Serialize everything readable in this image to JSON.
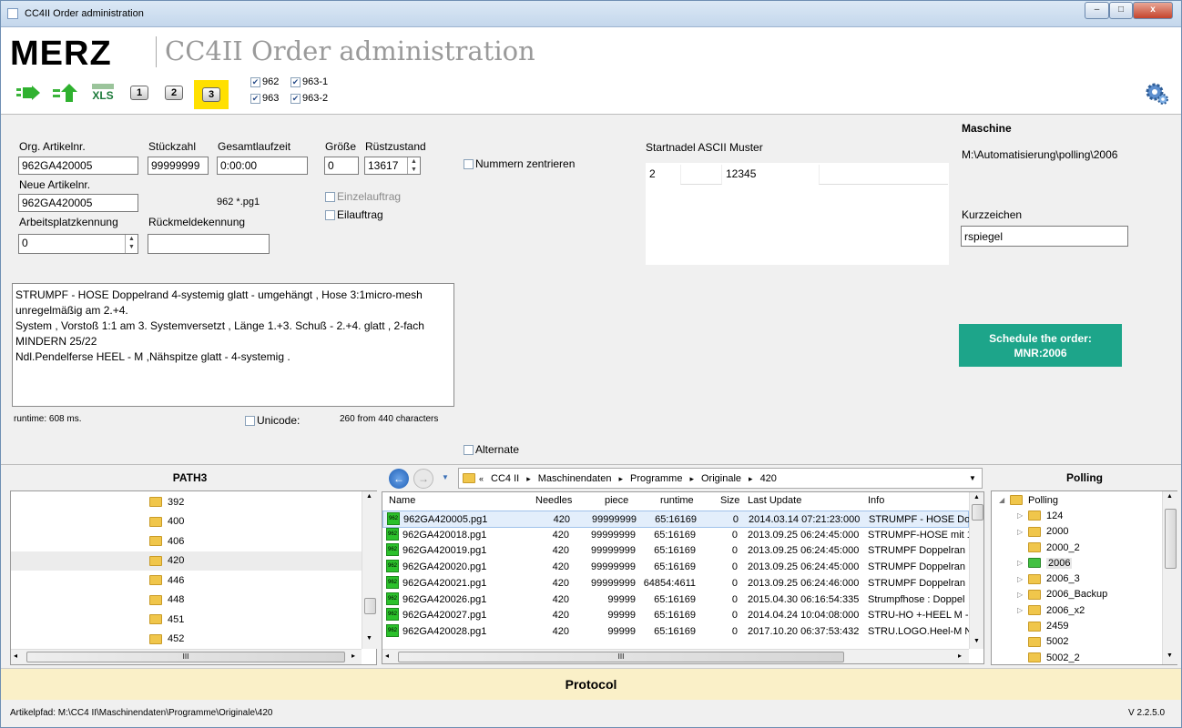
{
  "window": {
    "title": "CC4II Order administration",
    "min": "–",
    "max": "□",
    "close": "x"
  },
  "header": {
    "logo": "MERZ",
    "app_title": "CC4II Order administration",
    "toolbar": {
      "xls": "XLS",
      "btn1": "1",
      "btn2": "2",
      "btn3": "3"
    },
    "checks": [
      {
        "label": "962",
        "checked": true
      },
      {
        "label": "963-1",
        "checked": true
      },
      {
        "label": "963",
        "checked": true
      },
      {
        "label": "963-2",
        "checked": true
      }
    ]
  },
  "form": {
    "org_artikel_label": "Org. Artikelnr.",
    "org_artikel": "962GA420005",
    "stueckzahl_label": "Stückzahl",
    "stueckzahl": "99999999",
    "gesamtlaufzeit_label": "Gesamtlaufzeit",
    "gesamtlaufzeit": "0:00:00",
    "groesse_label": "Größe",
    "groesse": "0",
    "ruestzustand_label": "Rüstzustand",
    "ruestzustand": "13617",
    "neue_artikel_label": "Neue Artikelnr.",
    "neue_artikel": "962GA420005",
    "pattern_text": "962 *.pg1",
    "einzelauftrag": "Einzelauftrag",
    "eilauftrag": "Eilauftrag",
    "arbeitsplatz_label": "Arbeitsplatzkennung",
    "arbeitsplatz": "0",
    "rueckmelde_label": "Rückmeldekennung",
    "rueckmelde": "",
    "nummern_zentrieren": "Nummern zentrieren",
    "startnadel_label": "Startnadel ASCII Muster",
    "startnadel_value": "2",
    "ascii_value": "12345",
    "description_lines": [
      "STRUMPF - HOSE Doppelrand 4-systemig glatt - umgehängt , Hose 3:1micro-mesh",
      "unregelmäßig am 2.+4.",
      "System , Vorstoß 1:1 am 3. Systemversetzt , Länge 1.+3. Schuß - 2.+4. glatt , 2-fach",
      "MINDERN  25/22",
      "Ndl.Pendelferse HEEL - M ,Nähspitze glatt - 4-systemig ."
    ],
    "runtime": "runtime: 608 ms.",
    "unicode": "Unicode:",
    "char_count": "260 from 440 characters",
    "alternate": "Alternate"
  },
  "machine": {
    "title": "Maschine",
    "path": "M:\\Automatisierung\\polling\\2006",
    "kurzzeichen_label": "Kurzzeichen",
    "kurzzeichen": "rspiegel",
    "schedule_line1": "Schedule the order:",
    "schedule_line2": "MNR:2006"
  },
  "path3": {
    "title": "PATH3",
    "items": [
      "392",
      "400",
      "406",
      "420",
      "446",
      "448",
      "451",
      "452"
    ],
    "selected": "420",
    "hscroll": "III"
  },
  "browser": {
    "breadcrumb": [
      "«",
      "CC4 II",
      "▸",
      "Maschinendaten",
      "▸",
      "Programme",
      "▸",
      "Originale",
      "▸",
      "420"
    ],
    "columns": [
      "Name",
      "Needles",
      "piece",
      "runtime",
      "Size",
      "Last Update",
      "Info"
    ],
    "icon_text": "962",
    "rows": [
      [
        "962GA420005.pg1",
        "420",
        "99999999",
        "65:16169",
        "0",
        "2014.03.14 07:21:23:000",
        "STRUMPF - HOSE Dop"
      ],
      [
        "962GA420018.pg1",
        "420",
        "99999999",
        "65:16169",
        "0",
        "2013.09.25 06:24:45:000",
        "STRUMPF-HOSE mit 1"
      ],
      [
        "962GA420019.pg1",
        "420",
        "99999999",
        "65:16169",
        "0",
        "2013.09.25 06:24:45:000",
        "STRUMPF  Doppelran"
      ],
      [
        "962GA420020.pg1",
        "420",
        "99999999",
        "65:16169",
        "0",
        "2013.09.25 06:24:45:000",
        "STRUMPF  Doppelran"
      ],
      [
        "962GA420021.pg1",
        "420",
        "99999999",
        "64854:4611",
        "0",
        "2013.09.25 06:24:46:000",
        "STRUMPF  Doppelran"
      ],
      [
        "962GA420026.pg1",
        "420",
        "99999",
        "65:16169",
        "0",
        "2015.04.30 06:16:54:335",
        "Strumpfhose : Doppel"
      ],
      [
        "962GA420027.pg1",
        "420",
        "99999",
        "65:16169",
        "0",
        "2014.04.24 10:04:08:000",
        "STRU-HO +-HEEL M -"
      ],
      [
        "962GA420028.pg1",
        "420",
        "99999",
        "65:16169",
        "0",
        "2017.10.20 06:37:53:432",
        "STRU.LOGO.Heel-M N"
      ]
    ],
    "hscroll": "III"
  },
  "polling": {
    "title": "Polling",
    "items": [
      {
        "label": "Polling",
        "level": 0,
        "arrow": "◢"
      },
      {
        "label": "124",
        "level": 1,
        "arrow": "▷"
      },
      {
        "label": "2000",
        "level": 1,
        "arrow": "▷"
      },
      {
        "label": "2000_2",
        "level": 1,
        "arrow": ""
      },
      {
        "label": "2006",
        "level": 1,
        "arrow": "▷"
      },
      {
        "label": "2006_3",
        "level": 1,
        "arrow": "▷"
      },
      {
        "label": "2006_Backup",
        "level": 1,
        "arrow": "▷"
      },
      {
        "label": "2006_x2",
        "level": 1,
        "arrow": "▷"
      },
      {
        "label": "2459",
        "level": 1,
        "arrow": ""
      },
      {
        "label": "5002",
        "level": 1,
        "arrow": ""
      },
      {
        "label": "5002_2",
        "level": 1,
        "arrow": ""
      }
    ],
    "selected": "2006"
  },
  "protocol": {
    "title": "Protocol"
  },
  "status": {
    "path": "Artikelpfad: M:\\CC4 II\\Maschinendaten\\Programme\\Originale\\420",
    "version": "V 2.2.5.0"
  },
  "colors": {
    "accent": "#1da58a",
    "protocol_bg": "#faf0c8",
    "highlight": "#ffe000"
  }
}
